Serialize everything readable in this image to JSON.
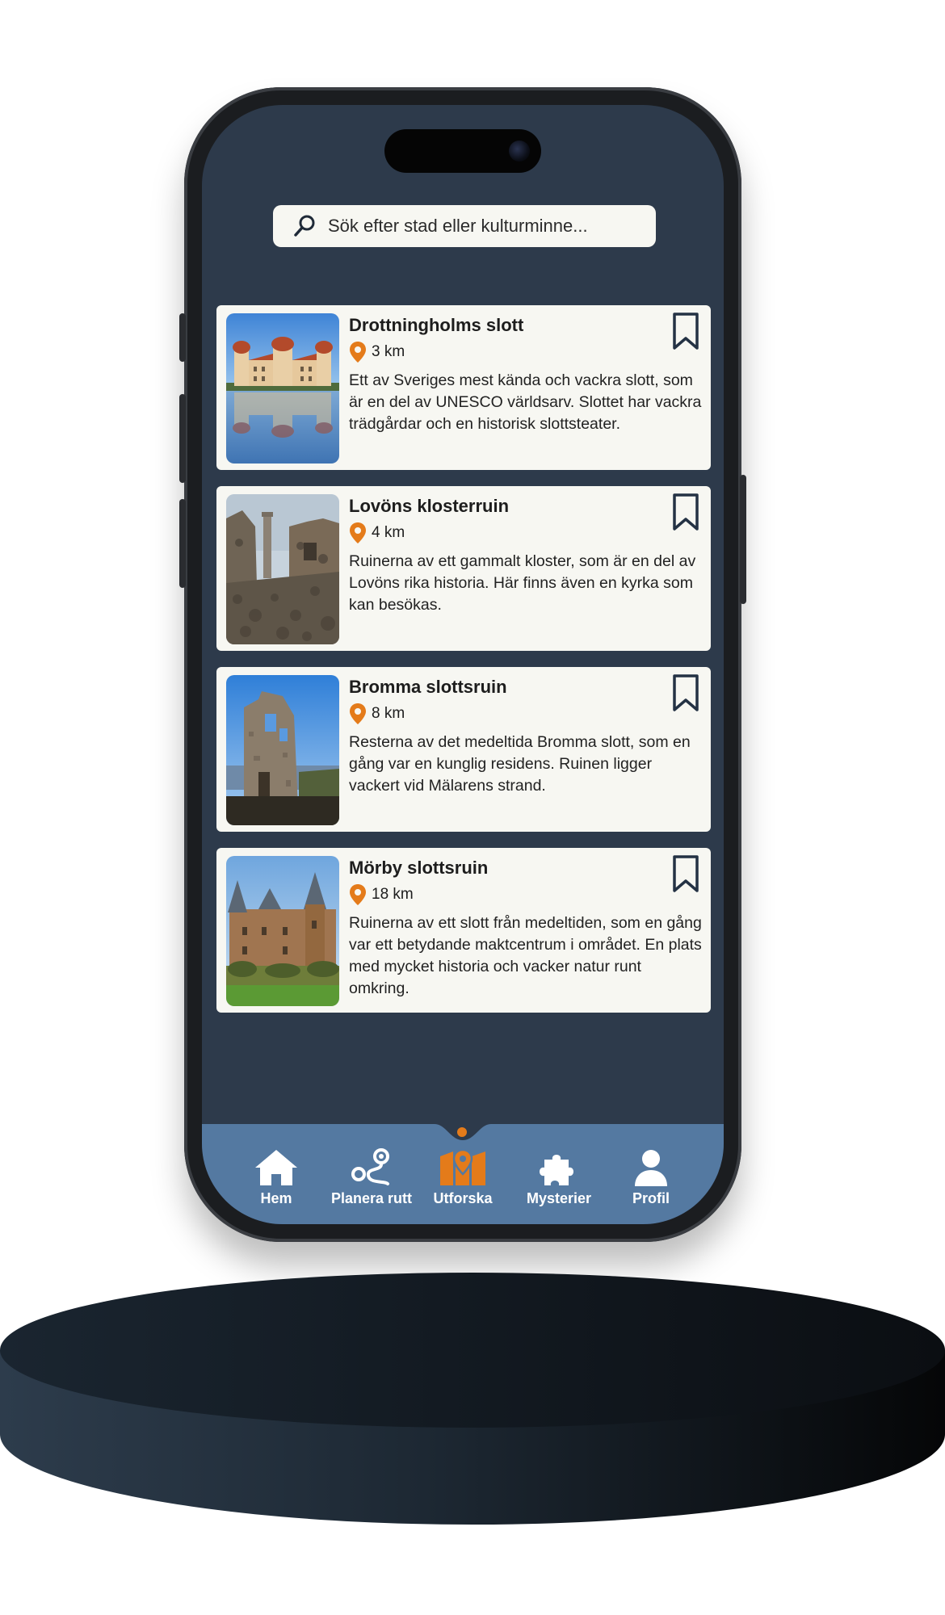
{
  "search": {
    "placeholder": "Sök efter stad eller kulturminne..."
  },
  "places": [
    {
      "title": "Drottningholms slott",
      "distance": "3 km",
      "description": "Ett av Sveriges mest kända och vackra slott, som är en del av UNESCO världsarv. Slottet har vackra trädgårdar och en historisk slottsteater."
    },
    {
      "title": "Lovöns klosterruin",
      "distance": "4 km",
      "description": "Ruinerna av ett gammalt kloster, som är en del av Lovöns rika historia. Här finns även en kyrka som kan besökas."
    },
    {
      "title": "Bromma slottsruin",
      "distance": "8 km",
      "description": "Resterna av det medeltida Bromma slott, som en gång var en kunglig residens. Ruinen ligger vackert vid Mälarens strand."
    },
    {
      "title": "Mörby slottsruin",
      "distance": "18 km",
      "description": "Ruinerna av ett slott från medeltiden, som en gång var ett betydande maktcentrum i området. En plats med mycket historia och vacker natur runt omkring."
    }
  ],
  "nav": {
    "items": [
      {
        "label": "Hem",
        "icon": "home-icon"
      },
      {
        "label": "Planera rutt",
        "icon": "route-icon"
      },
      {
        "label": "Utforska",
        "icon": "map-icon",
        "active": true
      },
      {
        "label": "Mysterier",
        "icon": "puzzle-icon"
      },
      {
        "label": "Profil",
        "icon": "user-icon"
      }
    ]
  },
  "colors": {
    "screen_bg": "#2d3a4b",
    "card_bg": "#f7f7f2",
    "accent": "#e47b1a",
    "nav_bg": "#5479a1"
  }
}
